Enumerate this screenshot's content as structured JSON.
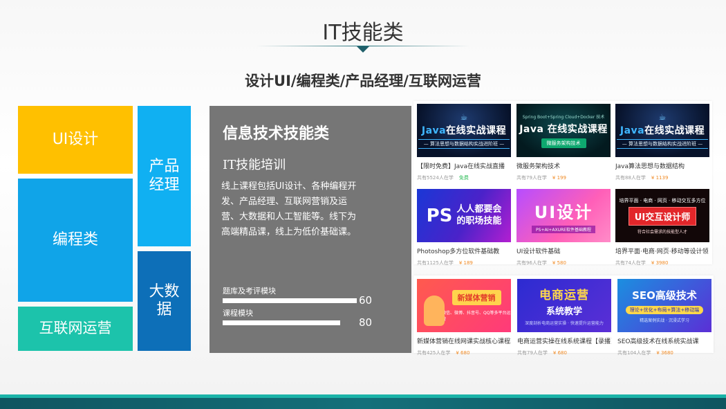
{
  "header": {
    "title": "IT技能类",
    "subtitle": "设计UI/编程类/产品经理/互联网运营"
  },
  "tiles": {
    "ui": "UI设计",
    "programming": "编程类",
    "internet_ops": "互联网运营",
    "product_manager": "产品\n经理",
    "big_data": "大数\n据"
  },
  "info_panel": {
    "heading": "信息技术技能类",
    "subheading": "IT技能培训",
    "description": "线上课程包括UI设计、各种编程开发、产品经理、互联网营销及运营、大数据和人工智能等。线下为高端精品课，线上为低价基础课。",
    "bars": [
      {
        "label": "题库及考评模块",
        "value": "60",
        "level": 0.6
      },
      {
        "label": "课程模块",
        "value": "80",
        "level": 0.8
      }
    ]
  },
  "courses": {
    "row1": [
      {
        "title": "【限时免费】Java在线实战直播",
        "students": "共有5524人在学",
        "price": "免费",
        "thumb": {
          "icon": "java-cup-icon",
          "headline_prefix": "Java",
          "headline": "在线实战课程",
          "tag": "— 算法思想与数据结构实战进阶班 —"
        }
      },
      {
        "title": "微服务架构技术",
        "students": "共有79人在学",
        "price": "¥ 199",
        "thumb": {
          "top": "Spring Boot+Spring Cloud+Docker 技术",
          "headline_prefix": "Java",
          "headline": " 在线实战课程",
          "tag": "微服务架构技术"
        }
      },
      {
        "title": "Java算法思想与数据结构",
        "students": "共有88人在学",
        "price": "¥ 1139",
        "thumb": {
          "icon": "java-cup-icon",
          "headline_prefix": "Java",
          "headline": "在线实战课程",
          "tag": "— 算法思想与数据结构实战进阶班 —"
        }
      }
    ],
    "row2": [
      {
        "title": "Photoshop多方位软件基础教",
        "students": "共有1125人在学",
        "price": "¥ 189",
        "thumb": {
          "badge": "PS",
          "line1": "人人都要会",
          "line2": "的职场技能"
        }
      },
      {
        "title": "UI设计软件基础",
        "students": "共有96人在学",
        "price": "¥ 580",
        "thumb": {
          "big": "UI设计",
          "small": "PS+AI+AXURE软件基础教程"
        }
      },
      {
        "title": "培界平面·电商·网页·移动等设计领",
        "students": "共有74人在学",
        "price": "¥ 3980",
        "thumb": {
          "top": "培界平面 · 电商 · 网页 · 移动交互多方位",
          "box": "UI交互设计师",
          "bottom": "符合社会需求的技能型人才"
        }
      }
    ],
    "row3": [
      {
        "title": "新媒体营销在线网课实战核心课程革新",
        "students": "共有425人在学",
        "price": "¥ 680",
        "thumb": {
          "badge": "新媒体营销",
          "line": "微信、微博、抖音号、QQ等多平台运营"
        }
      },
      {
        "title": "电商运营实操在线系统课程【录播】",
        "students": "共有79人在学",
        "price": "¥ 680",
        "thumb": {
          "big": "电商运营",
          "mid": "系统教学",
          "tags": "深度剖析电商运营实操 · 快速提升运营能力"
        }
      },
      {
        "title": "SEO高级技术在线系统实战课",
        "students": "共有104人在学",
        "price": "¥ 3680",
        "thumb": {
          "big": "SEO高级技术",
          "sub": "理论+优化+布局+算法+移动端",
          "bottom": "精选案例实战 · 沉浸式学习"
        }
      }
    ]
  },
  "colors": {
    "ui_tile": "#ffc000",
    "programming_tile": "#10a4e8",
    "internet_ops_tile": "#1cc3ab",
    "product_manager_tile": "#10b0f2",
    "big_data_tile": "#0d6fb8",
    "info_panel": "#767676",
    "price": "#f08a24",
    "free": "#2ebd59",
    "footer_teal": "#14707a"
  }
}
